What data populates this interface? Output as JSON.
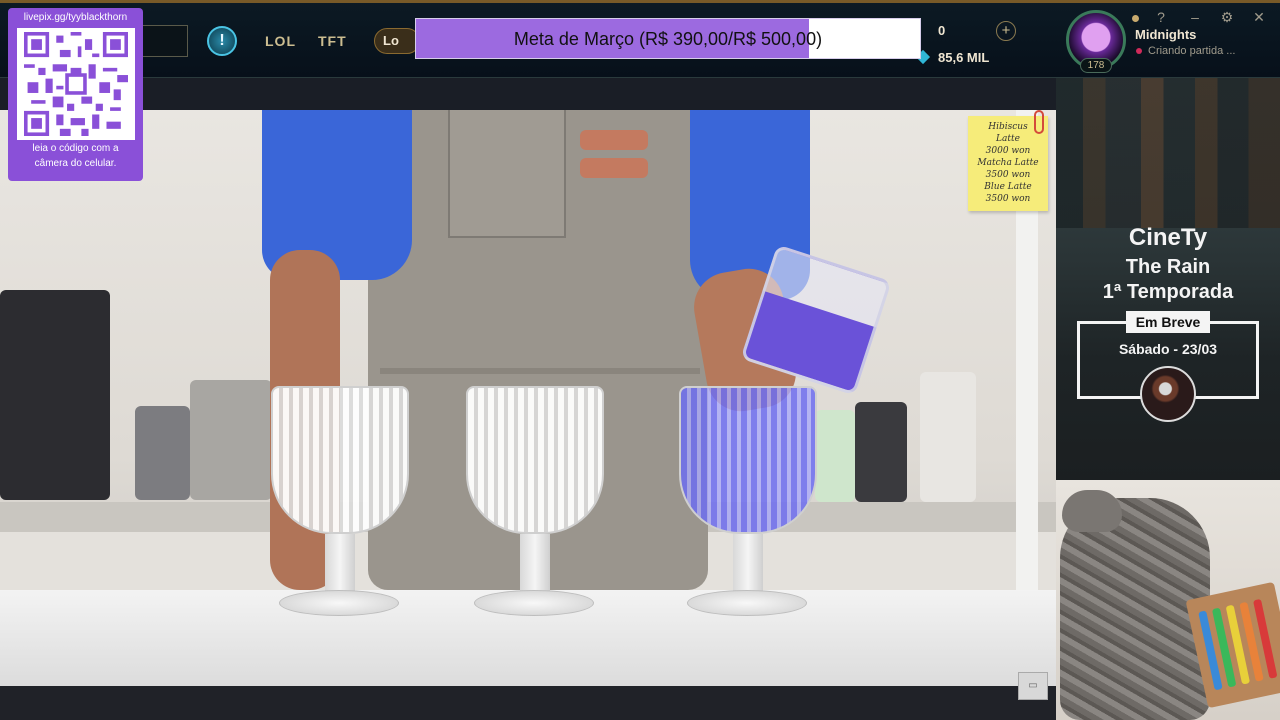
{
  "client": {
    "nav": {
      "lol": "LOL",
      "tft": "TFT",
      "loot_label": "Lo"
    },
    "currency": {
      "rp": "0",
      "plus": "+",
      "blue_essence": "85,6 MIL"
    },
    "profile": {
      "level": "178",
      "username": "Midnights",
      "status": "Criando partida ..."
    },
    "window_buttons": {
      "help": "?",
      "minimize": "‒",
      "settings": "⚙",
      "close": "✕"
    },
    "info_icon": "!"
  },
  "goal": {
    "text": "Meta de Março (R$ 390,00/R$ 500,00)",
    "current": 390,
    "target": 500,
    "fill_color": "#9c6ae0"
  },
  "qr": {
    "url": "livepix.gg/tyyblackthorn",
    "caption_line1": "leia o código com a",
    "caption_line2": "câmera do celular."
  },
  "note": {
    "lines": [
      "Hibiscus",
      "Latte",
      "3000 won",
      "Matcha Latte",
      "3500 won",
      "Blue Latte",
      "3500 won"
    ]
  },
  "side_panel": {
    "brand": "CineTy",
    "show": "The Rain",
    "season": "1ª Temporada",
    "soon_tag": "Em Breve",
    "date": "Sábado - 23/03"
  },
  "colors": {
    "accent_gold": "#c8aa6e",
    "goal_purple": "#9c6ae0",
    "qr_purple": "#8a50d8",
    "status_red": "#d02a5a"
  }
}
